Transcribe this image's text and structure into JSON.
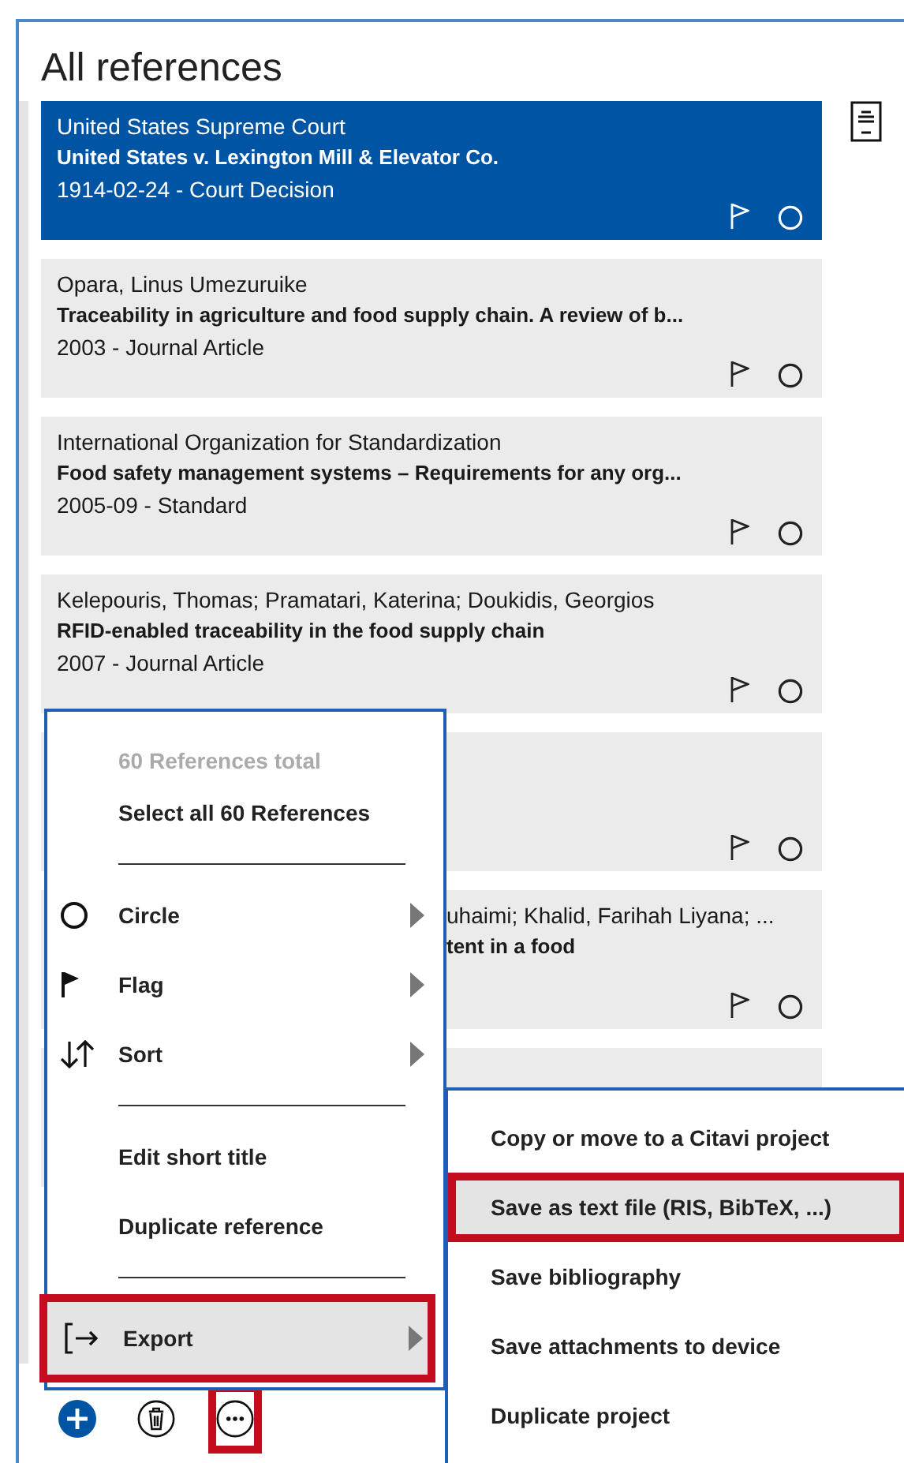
{
  "title": "All references",
  "references": [
    {
      "kind": "full",
      "selected": true,
      "author": "United States Supreme Court",
      "title": "United States v. Lexington Mill & Elevator Co.",
      "meta": "1914-02-24 - Court Decision"
    },
    {
      "kind": "full",
      "selected": false,
      "author": "Opara, Linus Umezuruike",
      "title": "Traceability in agriculture and food supply chain. A review of b...",
      "meta": "2003 - Journal Article"
    },
    {
      "kind": "full",
      "selected": false,
      "author": "International Organization for Standardization",
      "title": "Food safety management systems – Requirements for any org...",
      "meta": "2005-09 - Standard"
    },
    {
      "kind": "full",
      "selected": false,
      "author": "Kelepouris, Thomas; Pramatari, Katerina; Doukidis, Georgios",
      "title": "RFID-enabled traceability in the food supply chain",
      "meta": "2007 - Journal Article"
    },
    {
      "kind": "covered",
      "selected": false
    },
    {
      "kind": "covered",
      "selected": false,
      "author": "uhaimi; Khalid, Farihah Liyana; ...",
      "title": "tent in a food"
    },
    {
      "kind": "hidden",
      "selected": false
    }
  ],
  "menu": {
    "header": "60 References total",
    "items": [
      {
        "kind": "plain",
        "label": "Select all 60 References",
        "highlighted": false
      },
      {
        "kind": "divider"
      },
      {
        "kind": "circle",
        "label": "Circle",
        "highlighted": false
      },
      {
        "kind": "flag",
        "label": "Flag",
        "highlighted": false
      },
      {
        "kind": "sort",
        "label": "Sort",
        "highlighted": false
      },
      {
        "kind": "divider"
      },
      {
        "kind": "plain",
        "label": "Edit short title",
        "highlighted": false
      },
      {
        "kind": "plain",
        "label": "Duplicate reference",
        "highlighted": false
      },
      {
        "kind": "divider"
      },
      {
        "kind": "export",
        "label": "Export",
        "highlighted": true
      }
    ]
  },
  "submenu": [
    {
      "label": "Copy or move to a Citavi project",
      "highlighted": false
    },
    {
      "label": "Save as text file (RIS, BibTeX, ...)",
      "highlighted": true
    },
    {
      "label": "Save bibliography",
      "highlighted": false
    },
    {
      "label": "Save attachments to device",
      "highlighted": false
    },
    {
      "label": "Duplicate project",
      "highlighted": false
    }
  ],
  "toolbar": [
    {
      "kind": "add",
      "highlighted": false
    },
    {
      "kind": "delete",
      "highlighted": false
    },
    {
      "kind": "more",
      "highlighted": true
    }
  ]
}
